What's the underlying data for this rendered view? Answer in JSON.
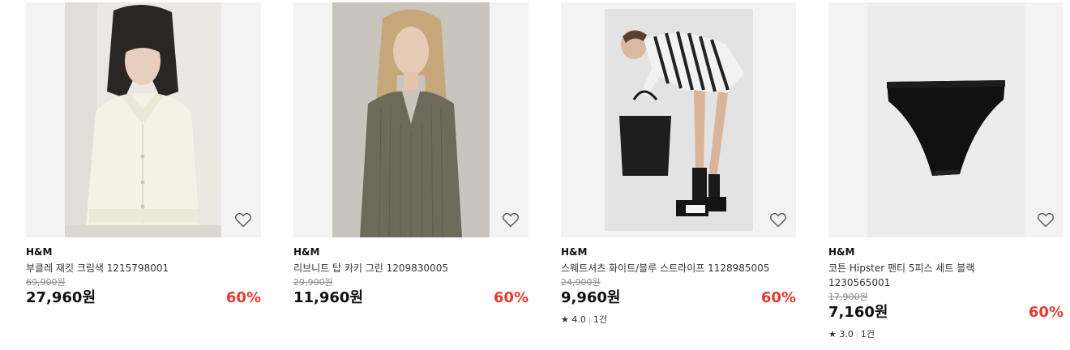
{
  "products": [
    {
      "brand": "H&M",
      "name": "부클레 재킷 크림색 1215798001",
      "original_price": "69,900원",
      "price": "27,960원",
      "discount": "60%",
      "rating": null,
      "review_count": null
    },
    {
      "brand": "H&M",
      "name": "리브니트 탑 카키 그린 1209830005",
      "original_price": "29,900원",
      "price": "11,960원",
      "discount": "60%",
      "rating": null,
      "review_count": null
    },
    {
      "brand": "H&M",
      "name": "스웨트셔츠 화이트/블루 스트라이프 1128985005",
      "original_price": "24,900원",
      "price": "9,960원",
      "discount": "60%",
      "rating": "4.0",
      "review_count": "1건"
    },
    {
      "brand": "H&M",
      "name": "코튼 Hipster 팬티 5피스 세트 블랙 1230565001",
      "original_price": "17,900원",
      "price": "7,160원",
      "discount": "60%",
      "rating": "3.0",
      "review_count": "1건"
    }
  ],
  "icons": {
    "wishlist": "heart-outline-icon",
    "rating": "star-icon"
  },
  "colors": {
    "discount": "#e63b2e",
    "price": "#111111",
    "original_price": "#8a8a8a",
    "thumb_background": "#f3f3f3"
  }
}
